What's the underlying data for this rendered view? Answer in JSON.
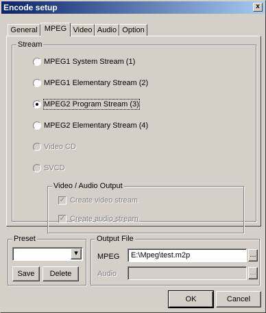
{
  "window": {
    "title": "Encode setup",
    "close_glyph": "x"
  },
  "tabs": [
    {
      "label": "General",
      "active": false
    },
    {
      "label": "MPEG",
      "active": true
    },
    {
      "label": "Video",
      "active": false
    },
    {
      "label": "Audio",
      "active": false
    },
    {
      "label": "Option",
      "active": false
    }
  ],
  "stream": {
    "legend": "Stream",
    "options": [
      {
        "label": "MPEG1 System Stream (1)",
        "selected": false,
        "enabled": true
      },
      {
        "label": "MPEG1 Elementary Stream (2)",
        "selected": false,
        "enabled": true
      },
      {
        "label": "MPEG2 Program Stream (3)",
        "selected": true,
        "enabled": true
      },
      {
        "label": "MPEG2 Elementary Stream (4)",
        "selected": false,
        "enabled": true
      },
      {
        "label": "Video CD",
        "selected": false,
        "enabled": false
      },
      {
        "label": "SVCD",
        "selected": false,
        "enabled": false
      }
    ],
    "output_group": {
      "legend": "Video / Audio Output",
      "create_video": {
        "label": "Create video stream",
        "checked": true,
        "enabled": false
      },
      "create_audio": {
        "label": "Create audio stream",
        "checked": true,
        "enabled": false
      }
    }
  },
  "preset": {
    "legend": "Preset",
    "combo_value": "",
    "save_label": "Save",
    "delete_label": "Delete"
  },
  "output_file": {
    "legend": "Output File",
    "mpeg_label": "MPEG",
    "mpeg_value": "E:\\Mpeg\\test.m2p",
    "audio_label": "Audio",
    "audio_value": "",
    "browse_label": "..."
  },
  "buttons": {
    "ok": "OK",
    "cancel": "Cancel"
  }
}
